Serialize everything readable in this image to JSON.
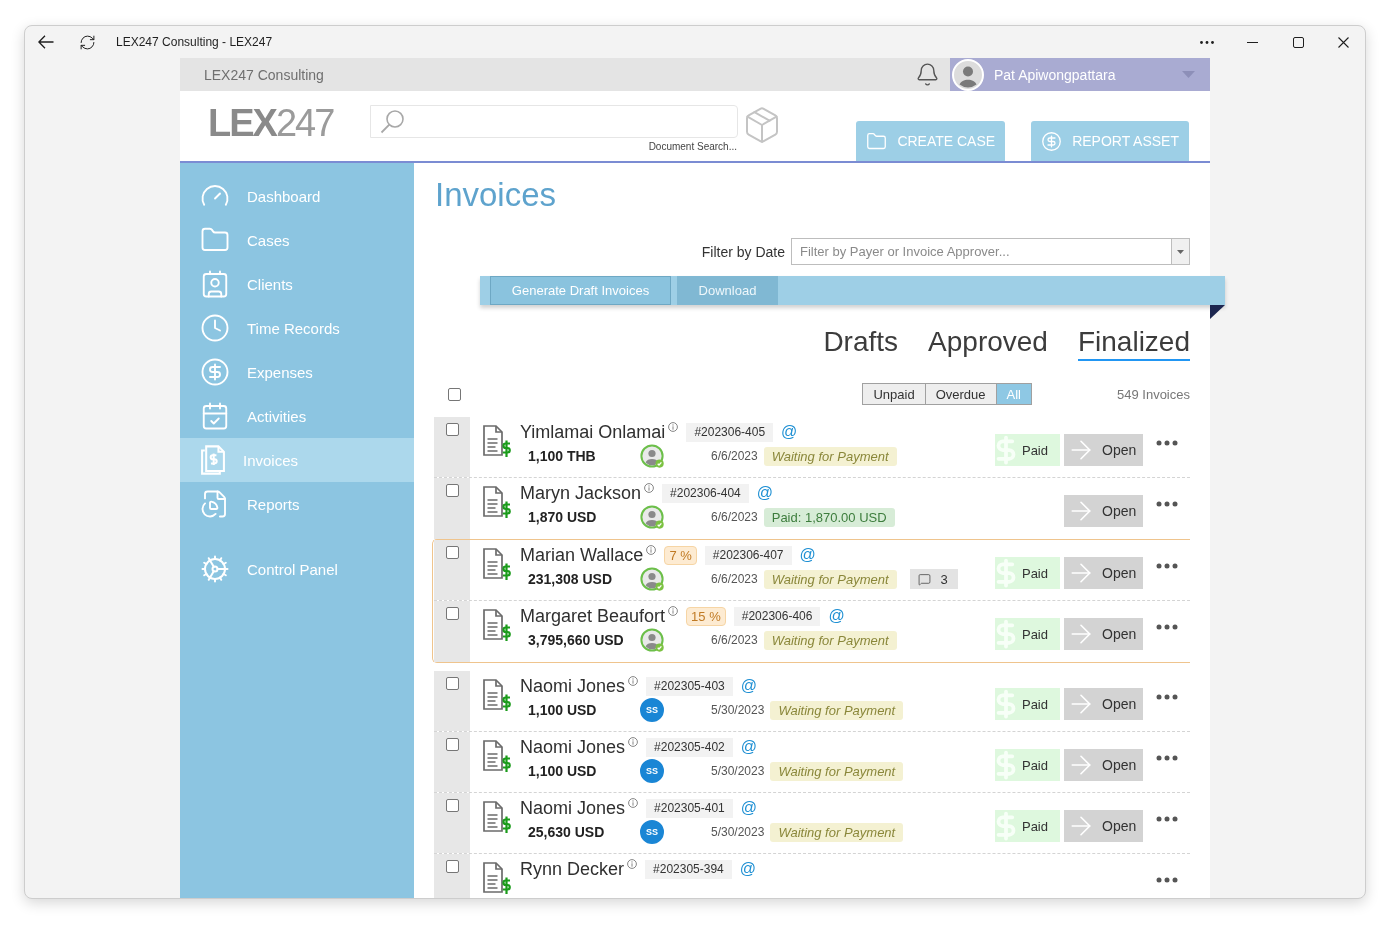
{
  "window": {
    "title": "LEX247 Consulting - LEX247"
  },
  "top_bar": {
    "firm": "LEX247 Consulting",
    "user": {
      "name": "Pat Apiwongpattara"
    }
  },
  "header": {
    "logo": "**LEX**247",
    "search": {
      "caption": "Document Search..."
    },
    "actions": [
      {
        "label": "CREATE CASE"
      },
      {
        "label": "REPORT ASSET"
      }
    ]
  },
  "sidebar": {
    "items": [
      {
        "label": "Dashboard",
        "selected": false
      },
      {
        "label": "Cases",
        "selected": false
      },
      {
        "label": "Clients",
        "selected": false
      },
      {
        "label": "Time Records",
        "selected": false
      },
      {
        "label": "Expenses",
        "selected": false
      },
      {
        "label": "Activities",
        "selected": false
      },
      {
        "label": "Invoices",
        "selected": true
      },
      {
        "label": "Reports",
        "selected": false
      }
    ],
    "footer_items": [
      {
        "label": "Control Panel",
        "selected": false
      }
    ]
  },
  "main": {
    "title": "Invoices",
    "filter": {
      "label": "Filter by Date",
      "placeholder": "Filter by Payer or Invoice Approver..."
    },
    "toolbar": [
      {
        "label": "Generate Draft Invoices",
        "disabled": false
      },
      {
        "label": "Download",
        "disabled": true
      }
    ],
    "tabs": [
      {
        "label": "Drafts",
        "selected": false
      },
      {
        "label": "Approved",
        "selected": false
      },
      {
        "label": "Finalized",
        "selected": true
      }
    ],
    "select_all": {
      "checked": false
    },
    "status_filter": [
      {
        "label": "Unpaid",
        "selected": false
      },
      {
        "label": "Overdue",
        "selected": false
      },
      {
        "label": "All",
        "selected": true
      }
    ],
    "count": "549 Invoices",
    "groups": [
      {
        "highlighted": false,
        "rows": [
          {
            "checked": false,
            "payer": "Yimlamai Onlamai",
            "number": "#202306-405",
            "mention": "@",
            "amount": "1,100 THB",
            "approver": {
              "kind": "photo",
              "approved": true
            },
            "date": "6/6/2023",
            "status": {
              "kind": "waiting",
              "label": "Waiting for Payment"
            },
            "actions": [
              {
                "kind": "paid",
                "label": "Paid"
              },
              {
                "kind": "open",
                "label": "Open"
              }
            ]
          },
          {
            "checked": false,
            "payer": "Maryn Jackson",
            "number": "#202306-404",
            "mention": "@",
            "amount": "1,870 USD",
            "approver": {
              "kind": "photo",
              "approved": true
            },
            "date": "6/6/2023",
            "status": {
              "kind": "paid",
              "label": "Paid: 1,870.00 USD"
            },
            "actions": [
              {
                "kind": "open",
                "label": "Open"
              }
            ]
          }
        ]
      },
      {
        "highlighted": true,
        "rows": [
          {
            "checked": false,
            "payer": "Marian Wallace",
            "percent": "7 %",
            "number": "#202306-407",
            "mention": "@",
            "amount": "231,308 USD",
            "approver": {
              "kind": "photo",
              "approved": true
            },
            "date": "6/6/2023",
            "status": {
              "kind": "waiting",
              "label": "Waiting for Payment"
            },
            "comments": "3",
            "actions": [
              {
                "kind": "paid",
                "label": "Paid"
              },
              {
                "kind": "open",
                "label": "Open"
              }
            ]
          },
          {
            "checked": false,
            "payer": "Margaret Beaufort",
            "percent": "15 %",
            "number": "#202306-406",
            "mention": "@",
            "amount": "3,795,660 USD",
            "approver": {
              "kind": "photo",
              "approved": true
            },
            "date": "6/6/2023",
            "status": {
              "kind": "waiting",
              "label": "Waiting for Payment"
            },
            "actions": [
              {
                "kind": "paid",
                "label": "Paid"
              },
              {
                "kind": "open",
                "label": "Open"
              }
            ]
          }
        ]
      },
      {
        "highlighted": false,
        "rows": [
          {
            "checked": false,
            "payer": "Naomi Jones",
            "number": "#202305-403",
            "mention": "@",
            "amount": "1,100 USD",
            "approver": {
              "kind": "initials",
              "initials": "SS",
              "approved": false
            },
            "date": "5/30/2023",
            "status": {
              "kind": "waiting",
              "label": "Waiting for Payment"
            },
            "actions": [
              {
                "kind": "paid",
                "label": "Paid"
              },
              {
                "kind": "open",
                "label": "Open"
              }
            ]
          },
          {
            "checked": false,
            "payer": "Naomi Jones",
            "number": "#202305-402",
            "mention": "@",
            "amount": "1,100 USD",
            "approver": {
              "kind": "initials",
              "initials": "SS",
              "approved": false
            },
            "date": "5/30/2023",
            "status": {
              "kind": "waiting",
              "label": "Waiting for Payment"
            },
            "actions": [
              {
                "kind": "paid",
                "label": "Paid"
              },
              {
                "kind": "open",
                "label": "Open"
              }
            ]
          },
          {
            "checked": false,
            "payer": "Naomi Jones",
            "number": "#202305-401",
            "mention": "@",
            "amount": "25,630 USD",
            "approver": {
              "kind": "initials",
              "initials": "SS",
              "approved": false
            },
            "date": "5/30/2023",
            "status": {
              "kind": "waiting",
              "label": "Waiting for Payment"
            },
            "actions": [
              {
                "kind": "paid",
                "label": "Paid"
              },
              {
                "kind": "open",
                "label": "Open"
              }
            ]
          },
          {
            "checked": false,
            "payer": "Rynn Decker",
            "number": "#202305-394",
            "mention": "@"
          }
        ]
      }
    ]
  }
}
